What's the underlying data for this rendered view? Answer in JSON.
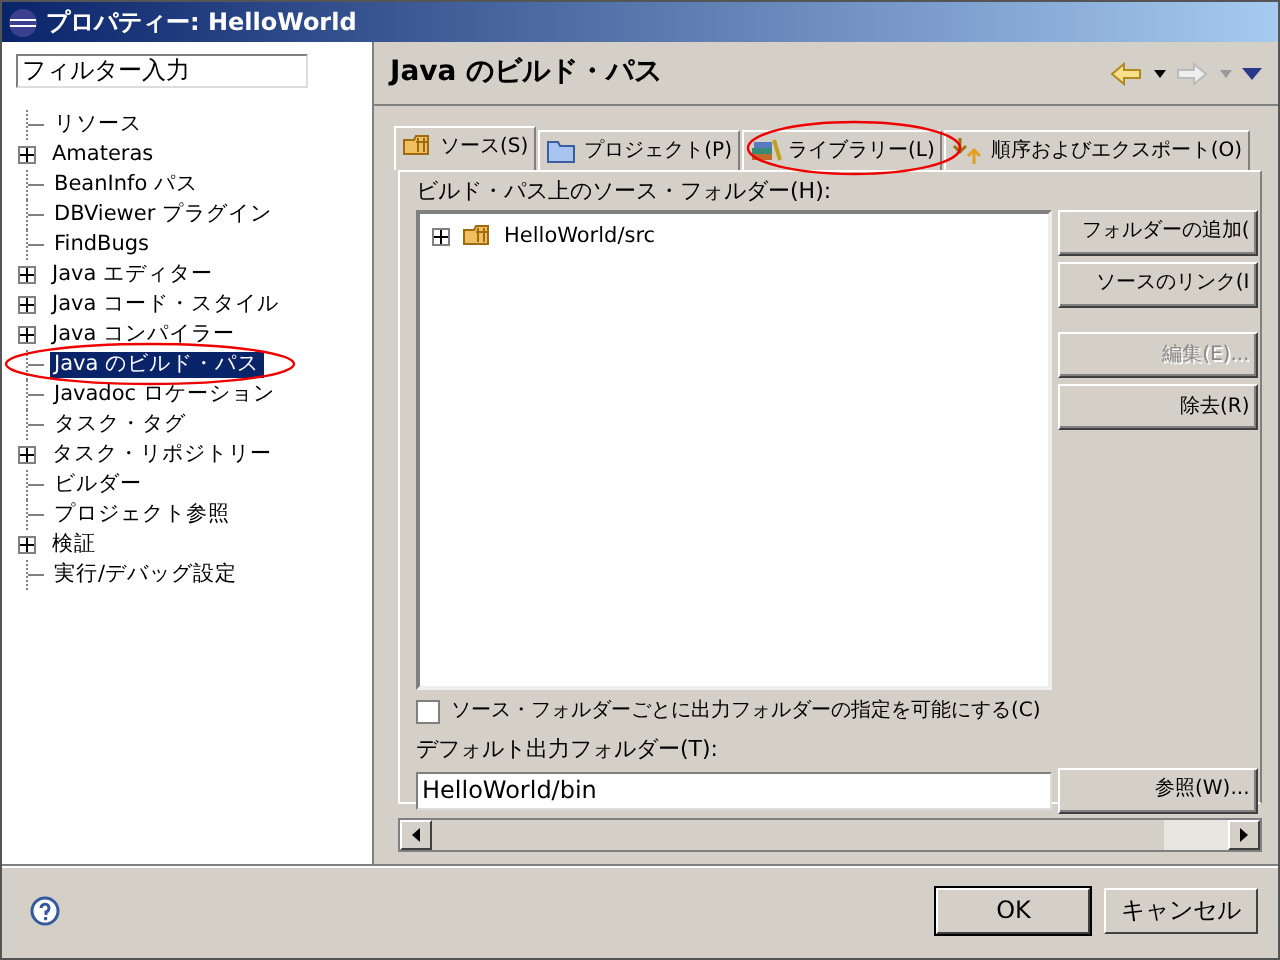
{
  "window": {
    "title": "プロパティー: HelloWorld"
  },
  "filter": {
    "value": "フィルター入力"
  },
  "tree": [
    {
      "label": "リソース",
      "expandable": false,
      "selected": false
    },
    {
      "label": "Amateras",
      "expandable": true,
      "selected": false
    },
    {
      "label": "BeanInfo パス",
      "expandable": false,
      "selected": false
    },
    {
      "label": "DBViewer プラグイン",
      "expandable": false,
      "selected": false
    },
    {
      "label": "FindBugs",
      "expandable": false,
      "selected": false
    },
    {
      "label": "Java エディター",
      "expandable": true,
      "selected": false
    },
    {
      "label": "Java コード・スタイル",
      "expandable": true,
      "selected": false
    },
    {
      "label": "Java コンパイラー",
      "expandable": true,
      "selected": false
    },
    {
      "label": "Java のビルド・パス",
      "expandable": false,
      "selected": true
    },
    {
      "label": "Javadoc ロケーション",
      "expandable": false,
      "selected": false
    },
    {
      "label": "タスク・タグ",
      "expandable": false,
      "selected": false
    },
    {
      "label": "タスク・リポジトリー",
      "expandable": true,
      "selected": false
    },
    {
      "label": "ビルダー",
      "expandable": false,
      "selected": false
    },
    {
      "label": "プロジェクト参照",
      "expandable": false,
      "selected": false
    },
    {
      "label": "検証",
      "expandable": true,
      "selected": false
    },
    {
      "label": "実行/デバッグ設定",
      "expandable": false,
      "selected": false
    }
  ],
  "page": {
    "title": "Java のビルド・パス"
  },
  "tabs": [
    {
      "label": "ソース(S)",
      "kind": "source",
      "selected": true
    },
    {
      "label": "プロジェクト(P)",
      "kind": "project",
      "selected": false
    },
    {
      "label": "ライブラリー(L)",
      "kind": "library",
      "selected": false
    },
    {
      "label": "順序およびエクスポート(O)",
      "kind": "order",
      "selected": false
    }
  ],
  "source_label": "ビルド・パス上のソース・フォルダー(H):",
  "source_tree": [
    {
      "label": "HelloWorld/src",
      "expandable": true
    }
  ],
  "side_buttons": [
    {
      "label": "フォルダーの追加(",
      "disabled": false
    },
    {
      "label": "ソースのリンク(I",
      "disabled": false
    },
    {
      "label": "編集(E)...",
      "disabled": true
    },
    {
      "label": "除去(R)",
      "disabled": false
    }
  ],
  "checkbox": {
    "label": "ソース・フォルダーごとに出力フォルダーの指定を可能にする(C)",
    "checked": false
  },
  "output_label": "デフォルト出力フォルダー(T):",
  "output_field": {
    "value": "HelloWorld/bin"
  },
  "browse_button": "参照(W)...",
  "buttons": [
    "OK",
    "キャンセル"
  ]
}
